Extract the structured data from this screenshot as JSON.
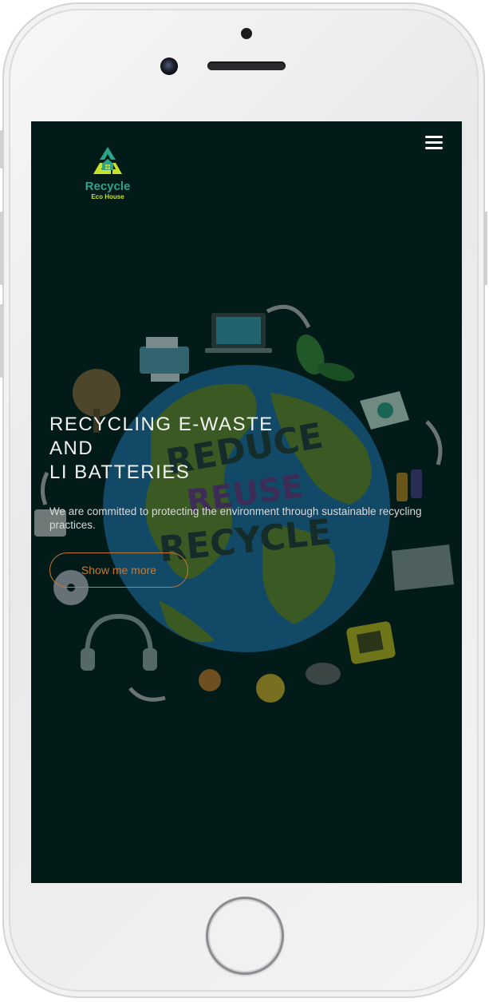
{
  "brand": {
    "name": "Recycle",
    "tagline": "Eco House",
    "primary_color": "#2fa38a",
    "accent_color": "#c7e02a"
  },
  "nav": {
    "menu_icon": "hamburger-menu-icon"
  },
  "hero": {
    "title_lines": [
      "RECYCLING E-WASTE",
      "AND",
      "LI BATTERIES"
    ],
    "illustration_text": [
      "REDUCE",
      "REUSE",
      "RECYCLE"
    ],
    "subtitle": "We are committed to protecting the environment through sustainable recycling practices.",
    "cta_label": "Show me more",
    "cta_color": "#c67a34",
    "background_color": "#031b18"
  }
}
